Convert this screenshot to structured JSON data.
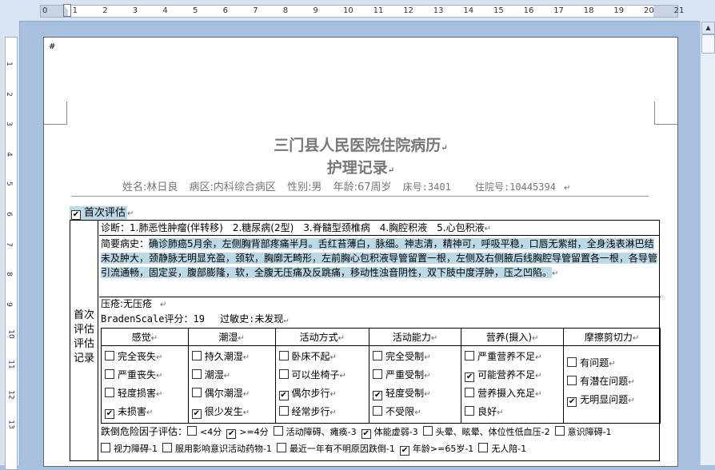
{
  "ruler": {
    "h_labels": [
      "0",
      "1",
      "2",
      "3",
      "4",
      "5",
      "6",
      "7",
      "8",
      "9",
      "10",
      "11",
      "12",
      "13",
      "14",
      "15",
      "16",
      "17",
      "18",
      "19",
      "20",
      "21"
    ],
    "v_labels": [
      "1",
      "2",
      "3",
      "4",
      "5",
      "6",
      "7",
      "8",
      "9",
      "10",
      "11",
      "12",
      "13"
    ]
  },
  "doc": {
    "hospital_title": "三门县人民医院住院病历",
    "record_title": "护理记录",
    "patient": {
      "name": "姓名:林日良",
      "ward": "病区:内科综合病区",
      "sex": "性别:男",
      "age": "年龄:67周岁",
      "bed": "床号:3401",
      "admission": "住院号:10445394"
    },
    "first_eval_label": "首次评估",
    "left_col_label": "首次评估评估记录",
    "diagnosis": "诊断：1.肺恶性肿瘤(伴转移)　2.糖尿病(2型)　3.脊髓型颈椎病　4.胸腔积液　5.心包积液",
    "history_label": "简要病史：",
    "history_text": "确诊肺癌5月余，左侧胸背部疼痛半月。舌红苔薄白，脉细。神志清，精神可，呼吸平稳，口唇无紫绀，全身浅表淋巴结未及肿大，颈静脉无明显充盈，颈软，胸廓无畸形，左前胸心包积液导管留置一根，左侧及右侧腋后线胸腔导管留置各一根，各导管引流通畅，固定妥，腹部膨隆，软，全腹无压痛及反跳痛，移动性浊音阴性，双下肢中度浮肿，压之凹陷。",
    "pressure_sore": "压疮:无压疮",
    "braden": "BradenScale评分：19　 过敏史:未发现",
    "grid": {
      "headers": [
        "感觉",
        "潮湿",
        "活动方式",
        "活动能力",
        "营养(摄入)",
        "摩擦剪切力"
      ],
      "columns": [
        [
          {
            "label": "完全丧失",
            "checked": false
          },
          {
            "label": "严重丧失",
            "checked": false
          },
          {
            "label": "轻度损害",
            "checked": false
          },
          {
            "label": "未损害",
            "checked": true
          }
        ],
        [
          {
            "label": "持久潮湿",
            "checked": false
          },
          {
            "label": "潮湿",
            "checked": false
          },
          {
            "label": "偶尔潮湿",
            "checked": false
          },
          {
            "label": "很少发生",
            "checked": true
          }
        ],
        [
          {
            "label": "卧床不起",
            "checked": false
          },
          {
            "label": "可以坐椅子",
            "checked": false
          },
          {
            "label": "偶尔步行",
            "checked": true
          },
          {
            "label": "经常步行",
            "checked": false
          }
        ],
        [
          {
            "label": "完全受制",
            "checked": false
          },
          {
            "label": "严重受制",
            "checked": false
          },
          {
            "label": "轻度受制",
            "checked": true
          },
          {
            "label": "不受限",
            "checked": false
          }
        ],
        [
          {
            "label": "严重营养不足",
            "checked": false
          },
          {
            "label": "可能营养不足",
            "checked": true
          },
          {
            "label": "营养摄入充足",
            "checked": false
          },
          {
            "label": "良好",
            "checked": false
          }
        ],
        [
          {
            "label": "有问题",
            "checked": false
          },
          {
            "label": "有潜在问题",
            "checked": false
          },
          {
            "label": "无明显问题",
            "checked": true
          }
        ]
      ]
    },
    "fall_label": "跌倒危险因子评估：",
    "fall_items_row1": [
      {
        "label": "<4分",
        "checked": false
      },
      {
        "label": ">=4分",
        "checked": true
      },
      {
        "label": "活动障碍、瘫痪-3",
        "checked": false
      },
      {
        "label": "体能虚弱-3",
        "checked": true
      },
      {
        "label": "头晕、眩晕、体位性低血压-2",
        "checked": false
      },
      {
        "label": "意识障碍-1",
        "checked": false
      }
    ],
    "fall_items_row2": [
      {
        "label": "视力障碍-1",
        "checked": false
      },
      {
        "label": "服用影响意识活动药物-1",
        "checked": false
      },
      {
        "label": "最近一年有不明原因跌倒-1",
        "checked": false
      },
      {
        "label": "年龄>=65岁-1",
        "checked": true
      },
      {
        "label": "无人陪-1",
        "checked": false
      }
    ]
  }
}
